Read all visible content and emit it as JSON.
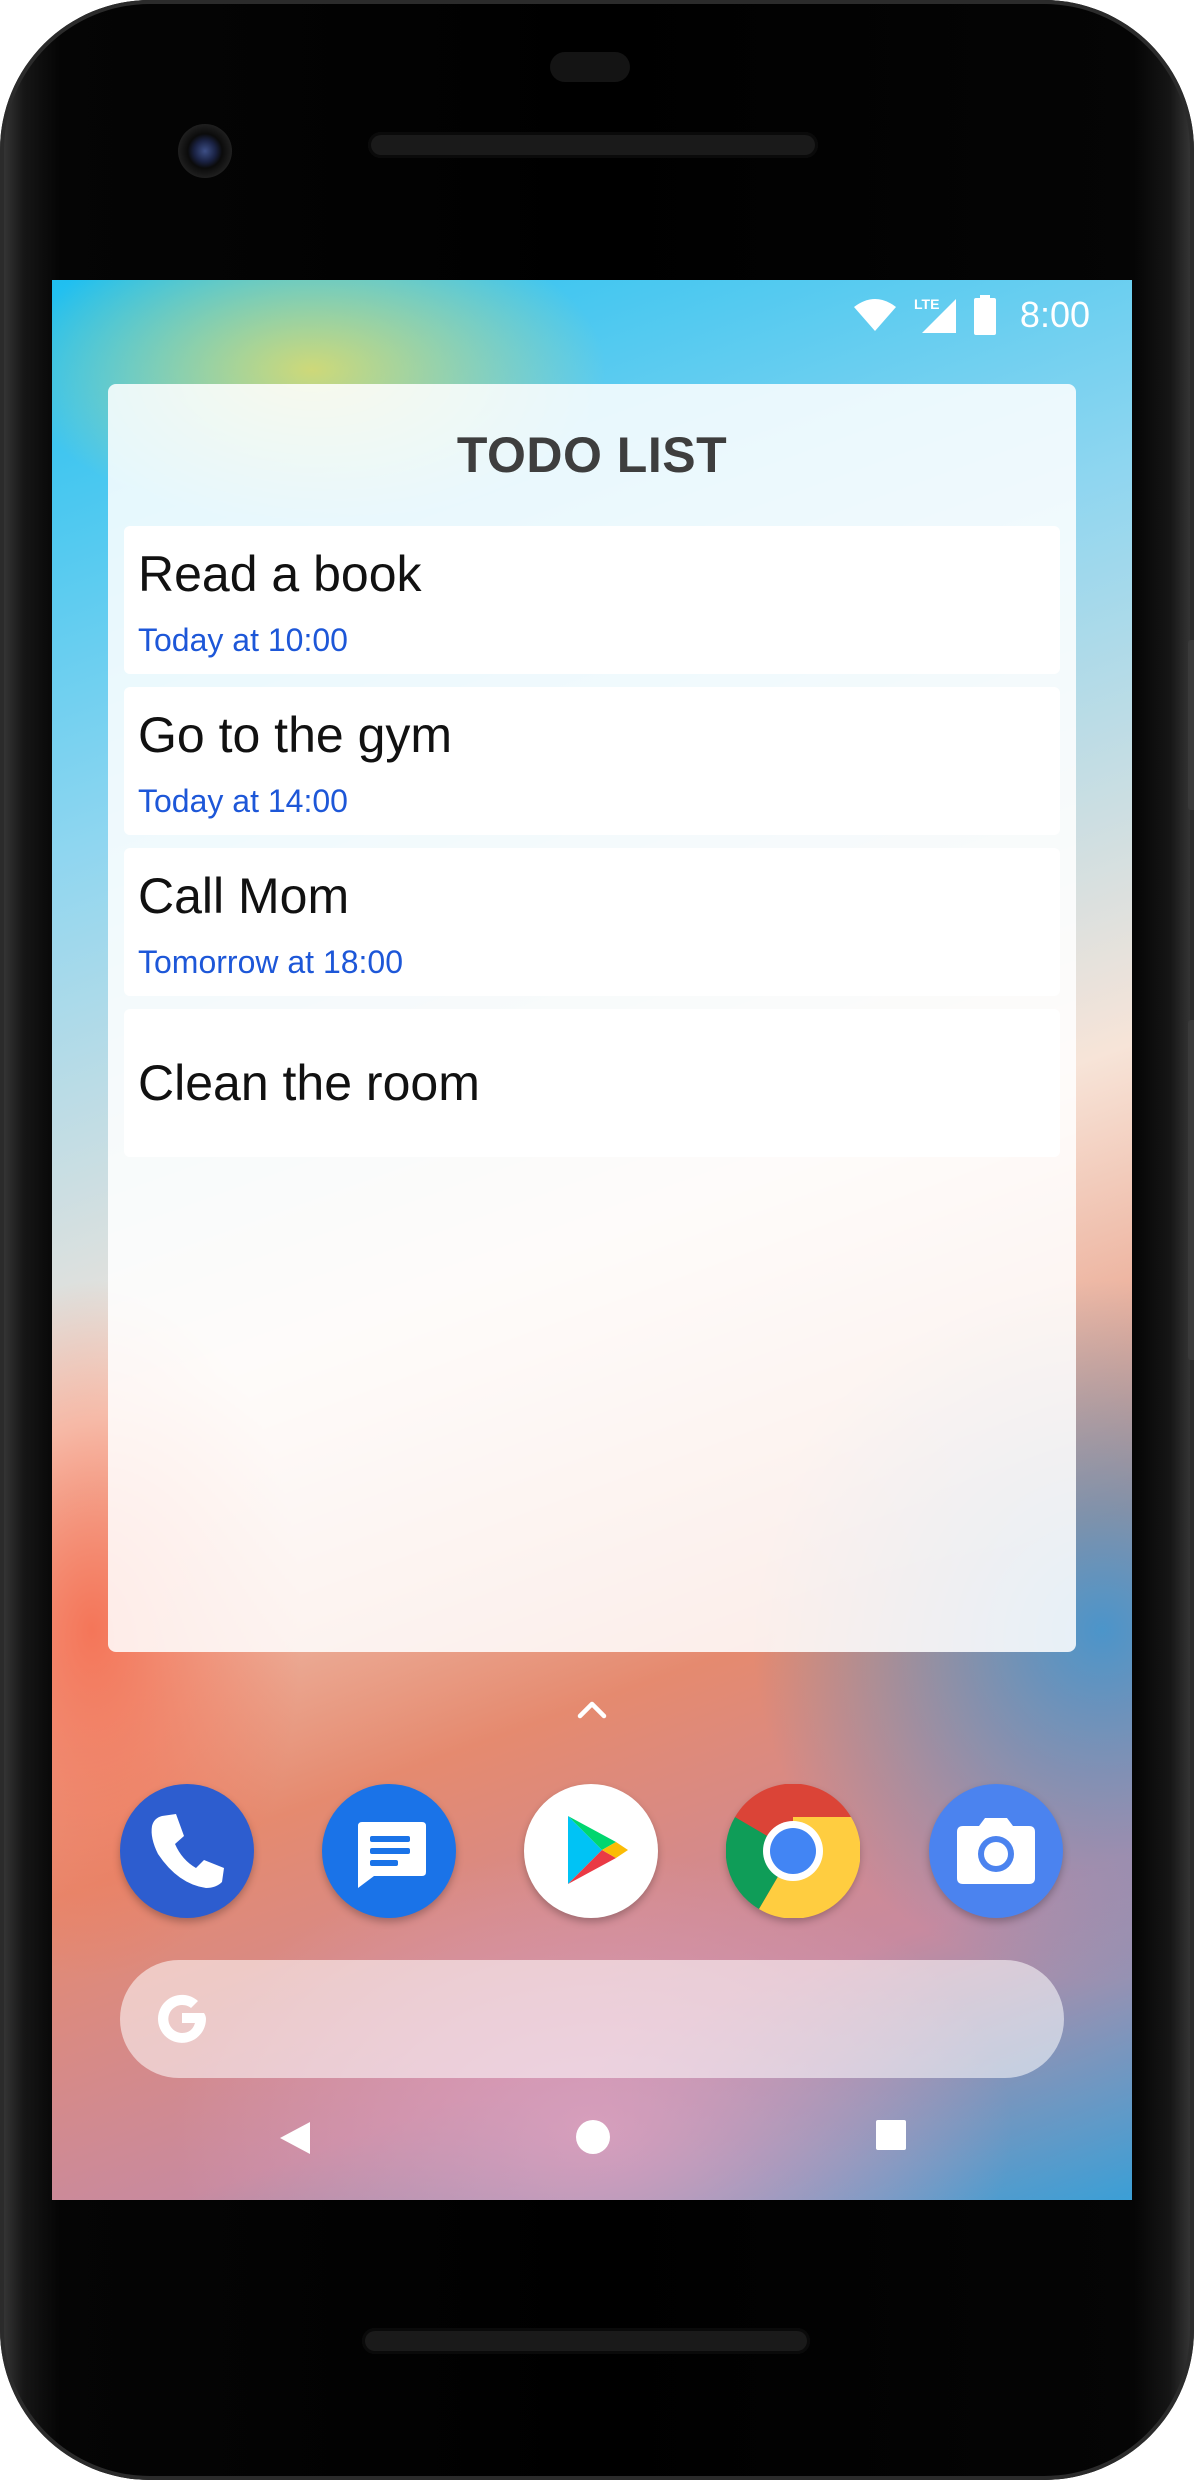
{
  "status_bar": {
    "time": "8:00",
    "network_label": "LTE",
    "icons": [
      "wifi-icon",
      "cellular-signal-icon",
      "battery-icon"
    ]
  },
  "widget": {
    "title": "TODO LIST",
    "items": [
      {
        "title": "Read a book",
        "time": "Today at 10:00"
      },
      {
        "title": "Go to the gym",
        "time": "Today at 14:00"
      },
      {
        "title": "Call Mom",
        "time": "Tomorrow at 18:00"
      },
      {
        "title": "Clean the room",
        "time": ""
      }
    ],
    "time_color": "#1d57d8"
  },
  "dock": {
    "apps": [
      "phone-icon",
      "messages-icon",
      "play-store-icon",
      "chrome-icon",
      "camera-icon"
    ]
  },
  "search": {
    "icon": "google-g-icon"
  },
  "nav": {
    "buttons": [
      "back-icon",
      "home-icon",
      "recents-icon"
    ]
  }
}
